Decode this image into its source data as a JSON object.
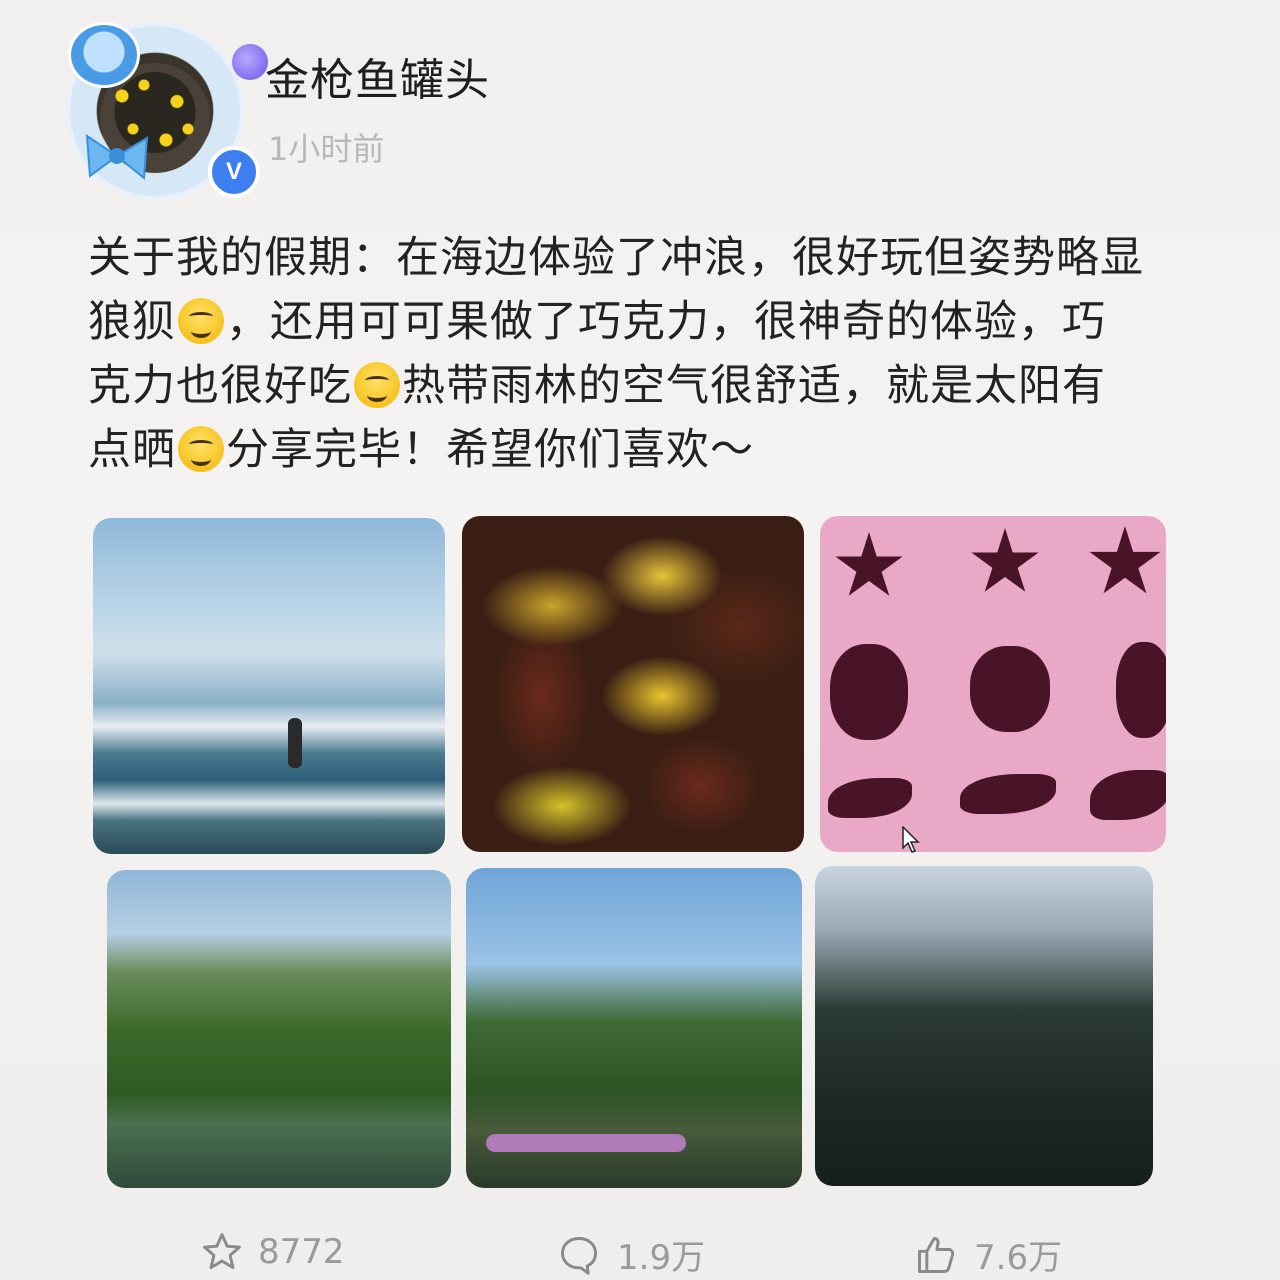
{
  "post": {
    "author": "金枪鱼罐头",
    "time": "1小时前",
    "text": {
      "line1": "关于我的假期：在海边体验了冲浪，很好玩但姿势略显",
      "line2a": "狼狈",
      "line2b": "，还用可可果做了巧克力，很神奇的体验，巧",
      "line3a": "克力也很好吃",
      "line3b": "热带雨林的空气很舒适，就是太阳有",
      "line4a": "点晒",
      "line4b": "分享完毕！希望你们喜欢～"
    },
    "emojis": [
      "rolling-laughing-emoji",
      "yum-face-emoji",
      "melting-face-emoji"
    ],
    "photos": [
      {
        "name": "photo-surfing"
      },
      {
        "name": "photo-cacao-pods"
      },
      {
        "name": "photo-chocolate-shapes"
      },
      {
        "name": "photo-paddleboard-river"
      },
      {
        "name": "photo-kayak-river"
      },
      {
        "name": "photo-palm-trees"
      }
    ]
  },
  "actions": {
    "favorite_count": "8772",
    "comment_count": "1.9万",
    "like_count": "7.6万"
  },
  "colors": {
    "background": "#f2f1ef",
    "text": "#222222",
    "muted": "#b8b8b8",
    "verified": "#3d7ff0"
  }
}
